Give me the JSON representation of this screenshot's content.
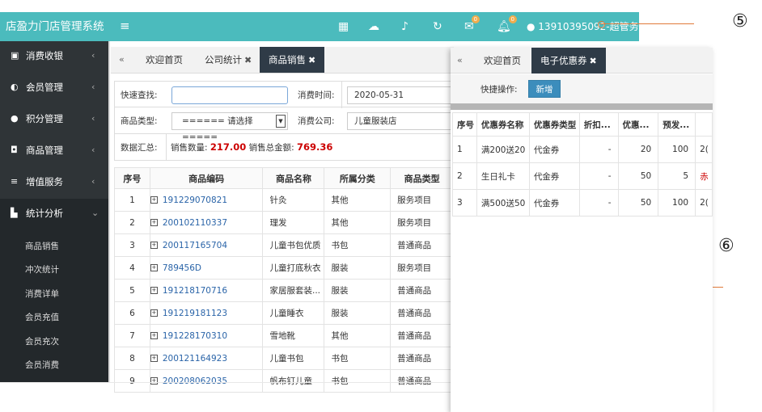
{
  "header": {
    "brand": "店盈力门店管理系统",
    "menu_icon": "≡",
    "mail_badge": "0",
    "bell_badge": "0",
    "user": "13910395092-超管务"
  },
  "notes": {
    "n5": "⑤",
    "n6": "⑥"
  },
  "sidebar": {
    "items": [
      {
        "label": "消费收银",
        "icon": "cashier-icon"
      },
      {
        "label": "会员管理",
        "icon": "members-icon"
      },
      {
        "label": "积分管理",
        "icon": "points-icon"
      },
      {
        "label": "商品管理",
        "icon": "goods-icon"
      },
      {
        "label": "增值服务",
        "icon": "service-icon"
      },
      {
        "label": "统计分析",
        "icon": "stats-icon"
      }
    ],
    "sub_items": [
      "商品销售",
      "冲次统计",
      "消费详单",
      "会员充值",
      "会员充次",
      "会员消费"
    ]
  },
  "tabs_left": [
    "欢迎首页",
    "公司统计",
    "商品销售"
  ],
  "filter": {
    "quick_search_label": "快速查找:",
    "quick_search_value": "",
    "time_label": "消费时间:",
    "time_value": "2020-05-31",
    "type_label": "商品类型:",
    "type_value": "====== 请选择 =====",
    "company_label": "消费公司:",
    "company_value": "儿童服装店",
    "summary_label": "数据汇总:",
    "qty_label": "销售数量:",
    "qty_value": "217.00",
    "amount_label": "销售总金额:",
    "amount_value": "769.36"
  },
  "sales_table": {
    "headers": [
      "序号",
      "商品编码",
      "商品名称",
      "所属分类",
      "商品类型"
    ],
    "rows": [
      [
        "1",
        "191229070821",
        "针灸",
        "其他",
        "服务项目"
      ],
      [
        "2",
        "200102110337",
        "理发",
        "其他",
        "服务项目"
      ],
      [
        "3",
        "200117165704",
        "儿童书包优质",
        "书包",
        "普通商品"
      ],
      [
        "4",
        "789456D",
        "儿童打底秋衣",
        "服装",
        "服务项目"
      ],
      [
        "5",
        "191218170716",
        "家居服套装...",
        "服装",
        "普通商品"
      ],
      [
        "6",
        "191219181123",
        "儿童睡衣",
        "服装",
        "普通商品"
      ],
      [
        "7",
        "191228170310",
        "雪地靴",
        "其他",
        "普通商品"
      ],
      [
        "8",
        "200121164923",
        "儿童书包",
        "书包",
        "普通商品"
      ],
      [
        "9",
        "200208062035",
        "帆布钉儿童",
        "书包",
        "普通商品"
      ]
    ]
  },
  "tabs_right": [
    "欢迎首页",
    "电子优惠券"
  ],
  "quick_ops_label": "快捷操作:",
  "add_button": "新增",
  "coupon_table": {
    "headers": [
      "序号",
      "优惠券名称",
      "优惠券类型",
      "折扣...",
      "优惠...",
      "预发..."
    ],
    "rows": [
      [
        "1",
        "满200送20",
        "代金券",
        "-",
        "20",
        "100",
        "2("
      ],
      [
        "2",
        "生日礼卡",
        "代金券",
        "-",
        "50",
        "5",
        "赤"
      ],
      [
        "3",
        "满500送50",
        "代金券",
        "-",
        "50",
        "100",
        "2("
      ]
    ]
  }
}
